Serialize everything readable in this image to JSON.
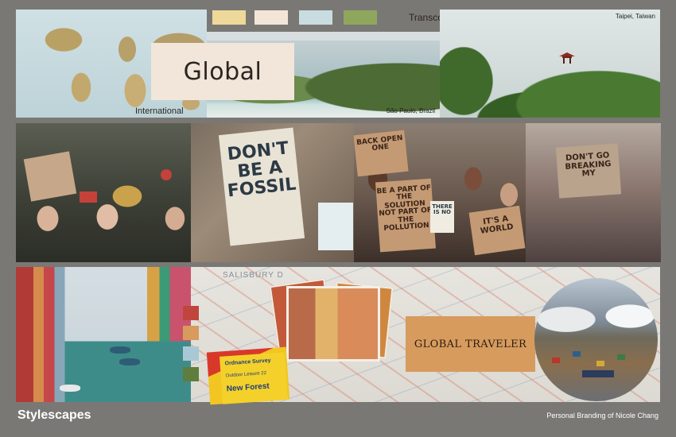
{
  "board": {
    "global_title": "Global",
    "international_label": "International",
    "transcontinental_label": "Transcontinental",
    "sao_paulo_caption": "São Paulo, Brazil",
    "taipei_caption": "Taipei, Taiwan",
    "traveler_title": "GLOBAL TRAVELER",
    "map_place_label": "SALISBURY D",
    "os_brand": "Ordnance Survey",
    "os_subtitle": "Outdoor Leisure 22",
    "os_title": "New Forest"
  },
  "signs": {
    "sign_dont": "DON'T BE A FOSSIL",
    "sign_back_open": "BACK OPEN ONE",
    "sign_solution": "BE A PART OF THE SOLUTION NOT PART OF THE POLLUTION",
    "sign_theres": "THERE IS NO",
    "sign_world": "IT'S A WORLD",
    "sign_dont_go": "DON'T GO BREAKING MY"
  },
  "palette": {
    "top_swatches": [
      "#efd99a",
      "#f3e6d8",
      "#c9dde0",
      "#8fa75c"
    ],
    "side_chips": [
      "#c0463d",
      "#d79b5e",
      "#a9c8d6",
      "#5f7d3c"
    ]
  },
  "footer": {
    "left_text": "Stylescapes",
    "right_text": "Personal Branding of Nicole Chang"
  }
}
